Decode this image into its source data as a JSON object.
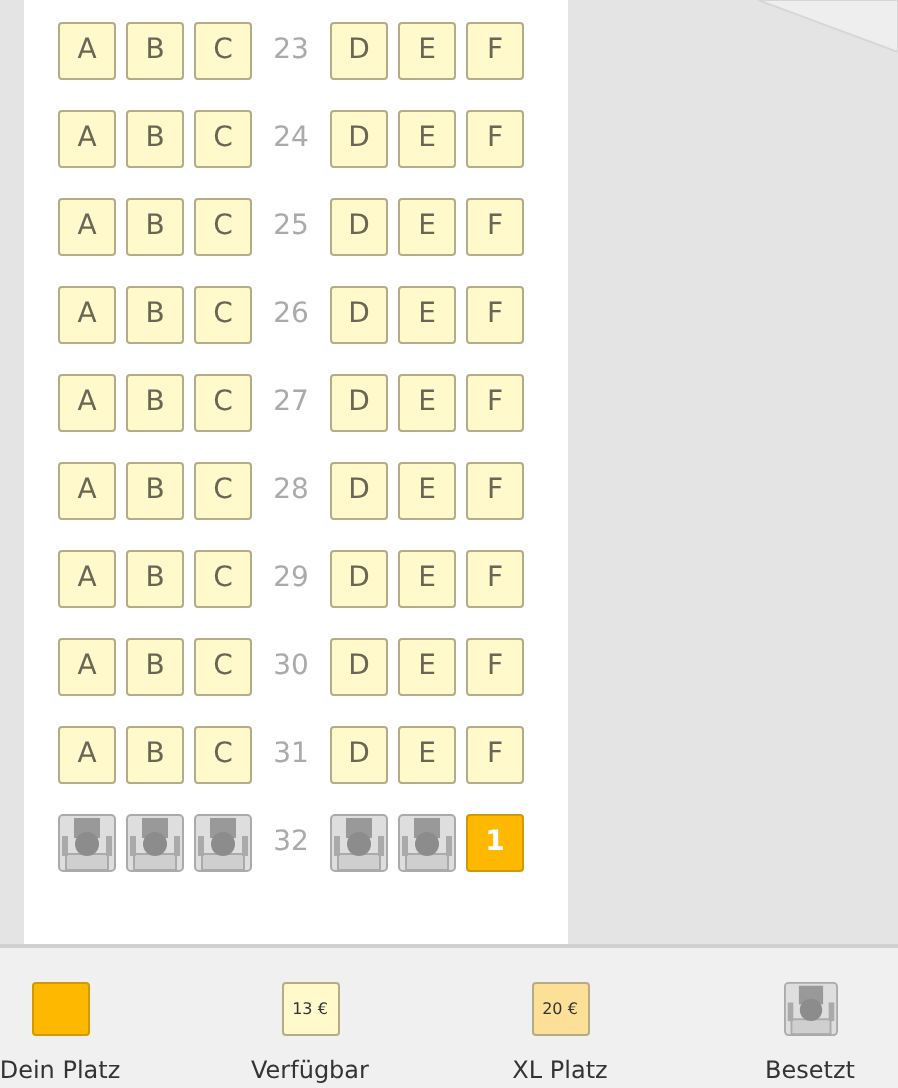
{
  "rows": [
    {
      "number": "23",
      "seats": [
        {
          "label": "A",
          "kind": "available"
        },
        {
          "label": "B",
          "kind": "available"
        },
        {
          "label": "C",
          "kind": "available"
        },
        {
          "label": "D",
          "kind": "available"
        },
        {
          "label": "E",
          "kind": "available"
        },
        {
          "label": "F",
          "kind": "available"
        }
      ]
    },
    {
      "number": "24",
      "seats": [
        {
          "label": "A",
          "kind": "available"
        },
        {
          "label": "B",
          "kind": "available"
        },
        {
          "label": "C",
          "kind": "available"
        },
        {
          "label": "D",
          "kind": "available"
        },
        {
          "label": "E",
          "kind": "available"
        },
        {
          "label": "F",
          "kind": "available"
        }
      ]
    },
    {
      "number": "25",
      "seats": [
        {
          "label": "A",
          "kind": "available"
        },
        {
          "label": "B",
          "kind": "available"
        },
        {
          "label": "C",
          "kind": "available"
        },
        {
          "label": "D",
          "kind": "available"
        },
        {
          "label": "E",
          "kind": "available"
        },
        {
          "label": "F",
          "kind": "available"
        }
      ]
    },
    {
      "number": "26",
      "seats": [
        {
          "label": "A",
          "kind": "available"
        },
        {
          "label": "B",
          "kind": "available"
        },
        {
          "label": "C",
          "kind": "available"
        },
        {
          "label": "D",
          "kind": "available"
        },
        {
          "label": "E",
          "kind": "available"
        },
        {
          "label": "F",
          "kind": "available"
        }
      ]
    },
    {
      "number": "27",
      "seats": [
        {
          "label": "A",
          "kind": "available"
        },
        {
          "label": "B",
          "kind": "available"
        },
        {
          "label": "C",
          "kind": "available"
        },
        {
          "label": "D",
          "kind": "available"
        },
        {
          "label": "E",
          "kind": "available"
        },
        {
          "label": "F",
          "kind": "available"
        }
      ]
    },
    {
      "number": "28",
      "seats": [
        {
          "label": "A",
          "kind": "available"
        },
        {
          "label": "B",
          "kind": "available"
        },
        {
          "label": "C",
          "kind": "available"
        },
        {
          "label": "D",
          "kind": "available"
        },
        {
          "label": "E",
          "kind": "available"
        },
        {
          "label": "F",
          "kind": "available"
        }
      ]
    },
    {
      "number": "29",
      "seats": [
        {
          "label": "A",
          "kind": "available"
        },
        {
          "label": "B",
          "kind": "available"
        },
        {
          "label": "C",
          "kind": "available"
        },
        {
          "label": "D",
          "kind": "available"
        },
        {
          "label": "E",
          "kind": "available"
        },
        {
          "label": "F",
          "kind": "available"
        }
      ]
    },
    {
      "number": "30",
      "seats": [
        {
          "label": "A",
          "kind": "available"
        },
        {
          "label": "B",
          "kind": "available"
        },
        {
          "label": "C",
          "kind": "available"
        },
        {
          "label": "D",
          "kind": "available"
        },
        {
          "label": "E",
          "kind": "available"
        },
        {
          "label": "F",
          "kind": "available"
        }
      ]
    },
    {
      "number": "31",
      "seats": [
        {
          "label": "A",
          "kind": "available"
        },
        {
          "label": "B",
          "kind": "available"
        },
        {
          "label": "C",
          "kind": "available"
        },
        {
          "label": "D",
          "kind": "available"
        },
        {
          "label": "E",
          "kind": "available"
        },
        {
          "label": "F",
          "kind": "available"
        }
      ]
    },
    {
      "number": "32",
      "seats": [
        {
          "kind": "occupied"
        },
        {
          "kind": "occupied"
        },
        {
          "kind": "occupied"
        },
        {
          "kind": "occupied"
        },
        {
          "kind": "occupied"
        },
        {
          "label": "1",
          "kind": "mine"
        }
      ]
    }
  ],
  "legend": [
    {
      "kind": "mine",
      "label": "Dein Platz"
    },
    {
      "kind": "available",
      "price": "13 €",
      "label": "Verfügbar"
    },
    {
      "kind": "xl",
      "price": "20 €",
      "label": "XL Platz"
    },
    {
      "kind": "occupied",
      "label": "Besetzt"
    }
  ]
}
